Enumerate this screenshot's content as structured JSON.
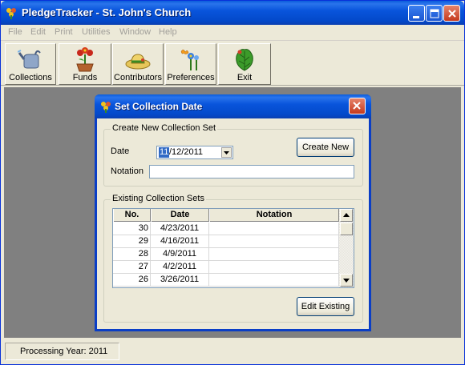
{
  "app": {
    "title": "PledgeTracker - St. John's Church"
  },
  "menu": [
    "File",
    "Edit",
    "Print",
    "Utilities",
    "Window",
    "Help"
  ],
  "toolbar": {
    "collections_label": "Collections",
    "funds_label": "Funds",
    "contributors_label": "Contributors",
    "preferences_label": "Preferences",
    "exit_label": "Exit"
  },
  "status": {
    "processing_year": "Processing Year: 2011"
  },
  "dialog": {
    "title": "Set Collection Date",
    "create_group_label": "Create New Collection Set",
    "date_label": "Date",
    "date_selected_part": "11",
    "date_rest": "/12/2011",
    "notation_label": "Notation",
    "notation_value": "",
    "create_new_label": "Create New",
    "existing_group_label": "Existing Collection Sets",
    "edit_existing_label": "Edit Existing",
    "table": {
      "headers": [
        "No.",
        "Date",
        "Notation"
      ],
      "rows": [
        {
          "no": "30",
          "date": "4/23/2011",
          "notation": ""
        },
        {
          "no": "29",
          "date": "4/16/2011",
          "notation": ""
        },
        {
          "no": "28",
          "date": "4/9/2011",
          "notation": ""
        },
        {
          "no": "27",
          "date": "4/2/2011",
          "notation": ""
        },
        {
          "no": "26",
          "date": "3/26/2011",
          "notation": ""
        }
      ]
    }
  },
  "colors": {
    "titlebar_blue": "#0348c9",
    "window_face": "#ece9d8",
    "mdi_background": "#808080",
    "close_red": "#c5391d"
  },
  "icons": {
    "app": "flower-app-icon",
    "collections": "watering-can-icon",
    "funds": "potted-flowers-icon",
    "contributors": "straw-hat-icon",
    "preferences": "flowers-butterfly-icon",
    "exit": "green-leaf-icon"
  }
}
